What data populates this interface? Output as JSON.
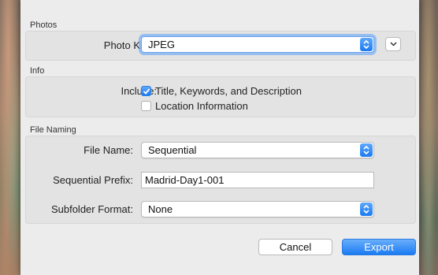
{
  "photos": {
    "section_label": "Photos",
    "photo_kind_label": "Photo Kind:",
    "photo_kind_value": "JPEG"
  },
  "info": {
    "section_label": "Info",
    "include_label": "Include:",
    "options": [
      {
        "label": "Title, Keywords, and Description",
        "checked": true
      },
      {
        "label": "Location Information",
        "checked": false
      }
    ]
  },
  "file_naming": {
    "section_label": "File Naming",
    "file_name_label": "File Name:",
    "file_name_value": "Sequential",
    "prefix_label": "Sequential Prefix:",
    "prefix_value": "Madrid-Day1-001",
    "subfolder_label": "Subfolder Format:",
    "subfolder_value": "None"
  },
  "buttons": {
    "cancel": "Cancel",
    "export": "Export"
  },
  "colors": {
    "accent": "#1a7af2",
    "sheet_bg": "#ececec"
  }
}
